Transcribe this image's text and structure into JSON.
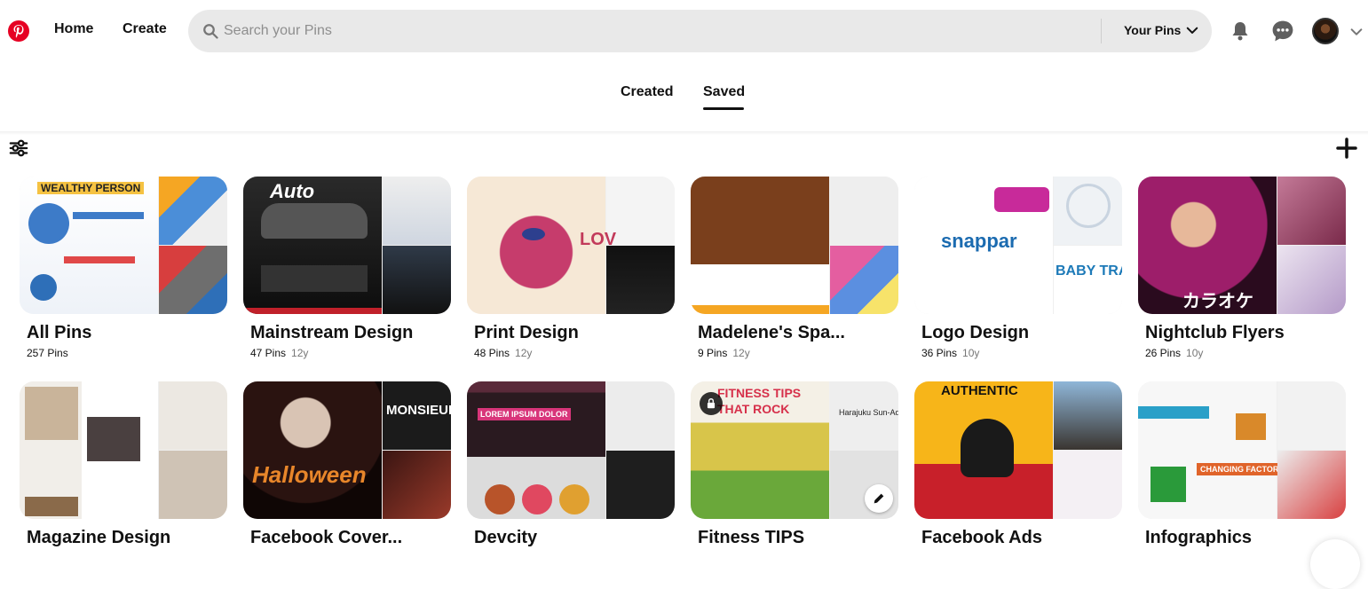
{
  "header": {
    "home_label": "Home",
    "create_label": "Create",
    "search_placeholder": "Search your Pins",
    "scope_label": "Your Pins",
    "icons": [
      "pinterest-logo",
      "search-icon",
      "chevron-down-icon",
      "bell-icon",
      "chat-icon",
      "avatar",
      "chevron-down-icon"
    ]
  },
  "tabs": {
    "created": "Created",
    "saved": "Saved",
    "active": "Saved"
  },
  "toolbar": {
    "icons": [
      "filter-icon",
      "plus-icon"
    ]
  },
  "boards": [
    {
      "title": "All Pins",
      "pins": "257 Pins",
      "age": "",
      "colors": [
        "#f4f6fb",
        "#dfe4ec",
        "#6a7480"
      ]
    },
    {
      "title": "Mainstream Design",
      "pins": "47 Pins",
      "age": "12y",
      "colors": [
        "#1a1a1a",
        "#d8d8d8",
        "#2a2a2a"
      ]
    },
    {
      "title": "Print Design",
      "pins": "48 Pins",
      "age": "12y",
      "colors": [
        "#c63c6c",
        "#f4f4f4",
        "#111111"
      ]
    },
    {
      "title": "Madelene's Spa...",
      "pins": "9 Pins",
      "age": "12y",
      "colors": [
        "#7a3f1c",
        "#e8e8e8",
        "#e45ea0"
      ]
    },
    {
      "title": "Logo Design",
      "pins": "36 Pins",
      "age": "10y",
      "colors": [
        "#ffffff",
        "#e9edf2",
        "#2f8fc3"
      ]
    },
    {
      "title": "Nightclub Flyers",
      "pins": "26 Pins",
      "age": "10y",
      "colors": [
        "#9d1e6a",
        "#c47a98",
        "#ece4f0"
      ]
    },
    {
      "title": "Magazine Design",
      "pins": "",
      "age": "",
      "colors": [
        "#f1eee9",
        "#ece8e2",
        "#cfc3b5"
      ]
    },
    {
      "title": "Facebook Cover...",
      "pins": "",
      "age": "",
      "colors": [
        "#2a1310",
        "#1b1b1b",
        "#3a1512"
      ]
    },
    {
      "title": "Devcity",
      "pins": "",
      "age": "",
      "colors": [
        "#d8d8d8",
        "#ececec",
        "#1e1e1e"
      ]
    },
    {
      "title": "Fitness TIPS",
      "pins": "",
      "age": "",
      "colors": [
        "#d8c54a",
        "#eeeeee",
        "#e2e2e2"
      ]
    },
    {
      "title": "Facebook Ads",
      "pins": "",
      "age": "",
      "colors": [
        "#f7b519",
        "#3a3530",
        "#f4f0f4"
      ]
    },
    {
      "title": "Infographics",
      "pins": "",
      "age": "",
      "colors": [
        "#f7f7f7",
        "#f2f2f2",
        "#ededed"
      ]
    }
  ],
  "cover_text": {
    "all_pins": "WEALTHY PERSON",
    "auto": "Auto",
    "logo": "snappar",
    "fitness": "FITNESS TIPS THAT ROCK",
    "harajuku": "Harajuku Sun-Ad",
    "authentic": "AUTHENTIC",
    "halloween": "Halloween",
    "monsieur": "MONSIEUR",
    "devcity": "LOREM IPSUM DOLOR",
    "infographics": "CHANGING FACTORS",
    "karaoke": "カラオケ",
    "love": "LOV",
    "baby": "BABY TRAV"
  }
}
